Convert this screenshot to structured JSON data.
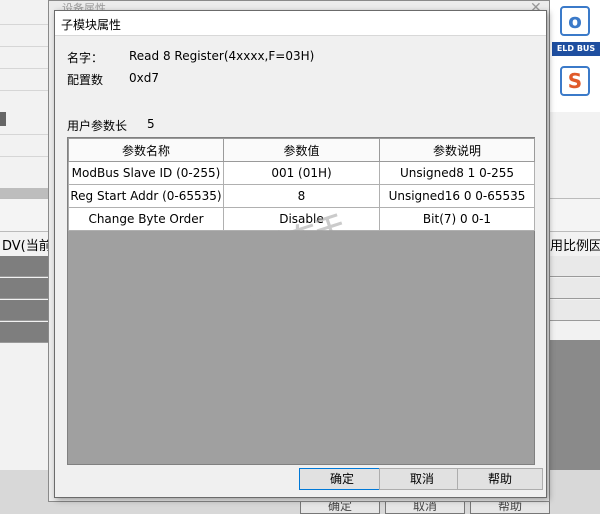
{
  "background": {
    "outer_title": "设备属性",
    "dv_label": "DV(当前",
    "ratio_label": "用比例因",
    "logo_letter_o": "o",
    "logo_field": "ELD BUS",
    "logo_letter_s": "S",
    "buttons": [
      "确定",
      "取消",
      "帮助"
    ]
  },
  "dialog": {
    "title": "子模块属性",
    "name_label": "名字：",
    "name_value": "Read 8 Register(4xxxx,F=03H)",
    "config_label": "配置数",
    "config_value": "0xd7",
    "user_param_label": "用户参数长",
    "user_param_value": "5",
    "table": {
      "headers": [
        "参数名称",
        "参数值",
        "参数说明"
      ],
      "rows": [
        [
          "ModBus Slave ID (0-255)",
          "001 (01H)",
          "Unsigned8 1 0-255"
        ],
        [
          "Reg Start Addr (0-65535)",
          "8",
          "Unsigned16 0 0-65535"
        ],
        [
          "Change Byte Order",
          "Disable",
          "Bit(7) 0 0-1"
        ]
      ]
    },
    "buttons": {
      "ok": "确定",
      "cancel": "取消",
      "help": "帮助"
    }
  },
  "watermark": {
    "line1": "发布于",
    "line2": "gongkong"
  }
}
